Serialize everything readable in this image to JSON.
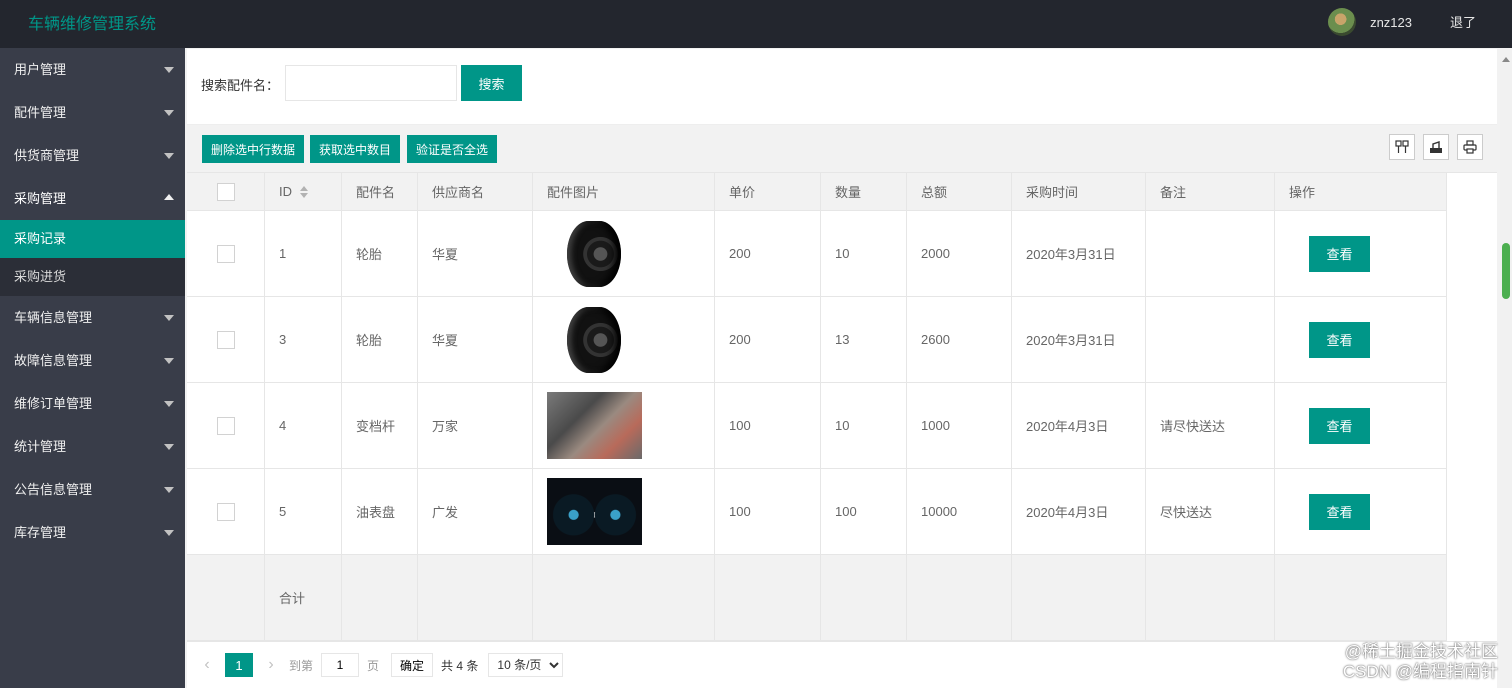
{
  "app": {
    "title": "车辆维修管理系统"
  },
  "user": {
    "name": "znz123",
    "logout": "退了"
  },
  "sidebar": {
    "items": [
      {
        "label": "用户管理"
      },
      {
        "label": "配件管理"
      },
      {
        "label": "供货商管理"
      },
      {
        "label": "采购管理",
        "open": true
      },
      {
        "label": "车辆信息管理"
      },
      {
        "label": "故障信息管理"
      },
      {
        "label": "维修订单管理"
      },
      {
        "label": "统计管理"
      },
      {
        "label": "公告信息管理"
      },
      {
        "label": "库存管理"
      }
    ],
    "subitems": [
      {
        "label": "采购记录",
        "active": true
      },
      {
        "label": "采购进货"
      }
    ]
  },
  "search": {
    "label": "搜索配件名：",
    "value": "",
    "placeholder": "",
    "button": "搜索"
  },
  "toolbar": {
    "delete_label": "删除选中行数据",
    "count_label": "获取选中数目",
    "check_all_label": "验证是否全选",
    "icons": [
      "columns-icon",
      "export-icon",
      "print-icon"
    ]
  },
  "table": {
    "headers": [
      "ID",
      "配件名",
      "供应商名",
      "配件图片",
      "单价",
      "数量",
      "总额",
      "采购时间",
      "备注",
      "操作"
    ],
    "rows": [
      {
        "id": "1",
        "part": "轮胎",
        "supplier": "华夏",
        "image": "tire",
        "price": "200",
        "qty": "10",
        "total": "2000",
        "time": "2020年3月31日",
        "note": "",
        "action": "查看"
      },
      {
        "id": "3",
        "part": "轮胎",
        "supplier": "华夏",
        "image": "tire",
        "price": "200",
        "qty": "13",
        "total": "2600",
        "time": "2020年3月31日",
        "note": "",
        "action": "查看"
      },
      {
        "id": "4",
        "part": "变档杆",
        "supplier": "万家",
        "image": "gear-shift",
        "price": "100",
        "qty": "10",
        "total": "1000",
        "time": "2020年4月3日",
        "note": "请尽快送达",
        "action": "查看"
      },
      {
        "id": "5",
        "part": "油表盘",
        "supplier": "广发",
        "image": "dashboard-gauge",
        "price": "100",
        "qty": "100",
        "total": "10000",
        "time": "2020年4月3日",
        "note": "尽快送达",
        "action": "查看"
      }
    ],
    "footer_label": "合计"
  },
  "pager": {
    "current": "1",
    "goto_label": "到第",
    "goto_value": "1",
    "page_label": "页",
    "confirm": "确定",
    "total": "共 4 条",
    "per_page": "10 条/页"
  },
  "watermark": {
    "line1": "@稀土掘金技术社区",
    "line2": "CSDN @编程指南针"
  }
}
